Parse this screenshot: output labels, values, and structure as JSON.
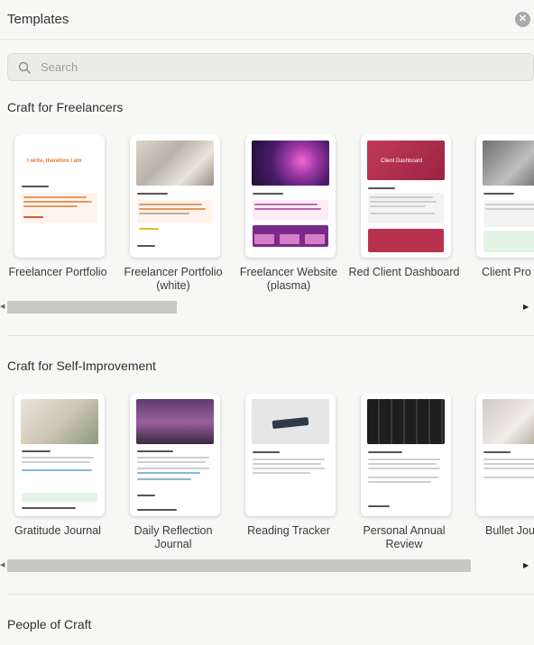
{
  "header": {
    "title": "Templates"
  },
  "search": {
    "placeholder": "Search"
  },
  "sections": [
    {
      "title": "Craft for Freelancers",
      "cards": [
        {
          "label": "Freelancer Portfolio"
        },
        {
          "label": "Freelancer Portfolio (white)"
        },
        {
          "label": "Freelancer Website (plasma)"
        },
        {
          "label": "Red Client Dashboard"
        },
        {
          "label": "Client Pro"
        }
      ]
    },
    {
      "title": "Craft for Self-Improvement",
      "cards": [
        {
          "label": "Gratitude Journal"
        },
        {
          "label": "Daily Reflection Journal"
        },
        {
          "label": "Reading Tracker"
        },
        {
          "label": "Personal Annual Review"
        },
        {
          "label": "Bullet Jou Templa"
        }
      ]
    },
    {
      "title": "People of Craft"
    }
  ],
  "thumbnails": {
    "freelancer_portfolio_hero": "I write, therefore I am",
    "client_dashboard_title": "Client Dashboard"
  },
  "colors": {
    "accent_orange": "#f08a3e",
    "plasma": "#7a2a8a",
    "client_red": "#b8324f",
    "green_tint": "#e3f4e4"
  }
}
